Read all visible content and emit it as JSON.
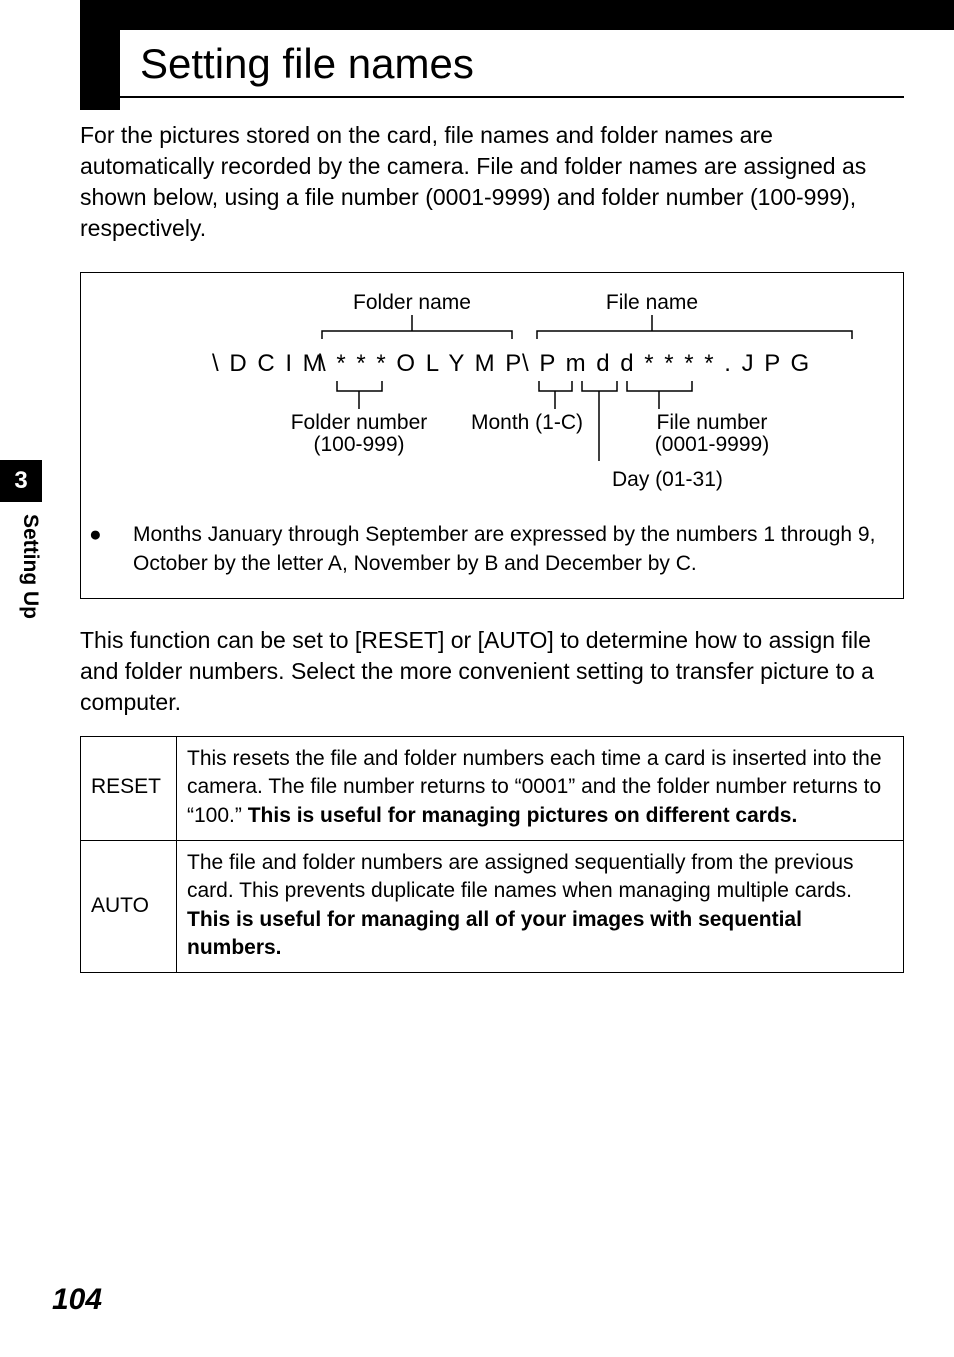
{
  "title": "Setting file names",
  "intro": "For the pictures stored on the card, file names and folder names are automatically recorded by the camera. File and folder names are assigned as shown below, using a file number (0001-9999) and folder number (100-999), respectively.",
  "diagram": {
    "folder_name_label": "Folder name",
    "file_name_label": "File name",
    "path_dcim": "\\ D C I M",
    "path_olymp": "\\ * * * O L Y M P",
    "path_pmdd": "\\ P m d d * * * * . J P G",
    "folder_number_label": "Folder number (100-999)",
    "folder_number_l1": "Folder number",
    "folder_number_l2": "(100-999)",
    "month_label": "Month (1-C)",
    "day_label": "Day (01-31)",
    "file_number_label": "File number (0001-9999)",
    "file_number_l1": "File number",
    "file_number_l2": "(0001-9999)"
  },
  "months_note": "Months January through September are expressed by the numbers 1 through 9, October by the letter A, November by B and December by C.",
  "mid_para": "This function can be set to [RESET] or [AUTO] to determine how to assign file and folder numbers. Select the more convenient setting to transfer picture to a computer.",
  "table": {
    "rows": [
      {
        "key": "RESET",
        "desc_plain": "This resets the file and folder numbers each time a card is inserted into the camera. The file number returns to “0001” and the folder number returns to “100.” ",
        "desc_bold": "This is useful for managing pictures on different cards."
      },
      {
        "key": "AUTO",
        "desc_plain": "The file and folder numbers are assigned sequentially from the previous card. This prevents duplicate file names when managing multiple cards. ",
        "desc_bold": "This is useful for managing all of your images with sequential numbers."
      }
    ]
  },
  "side_tab": {
    "number": "3",
    "label": "Setting Up"
  },
  "page_number": "104"
}
